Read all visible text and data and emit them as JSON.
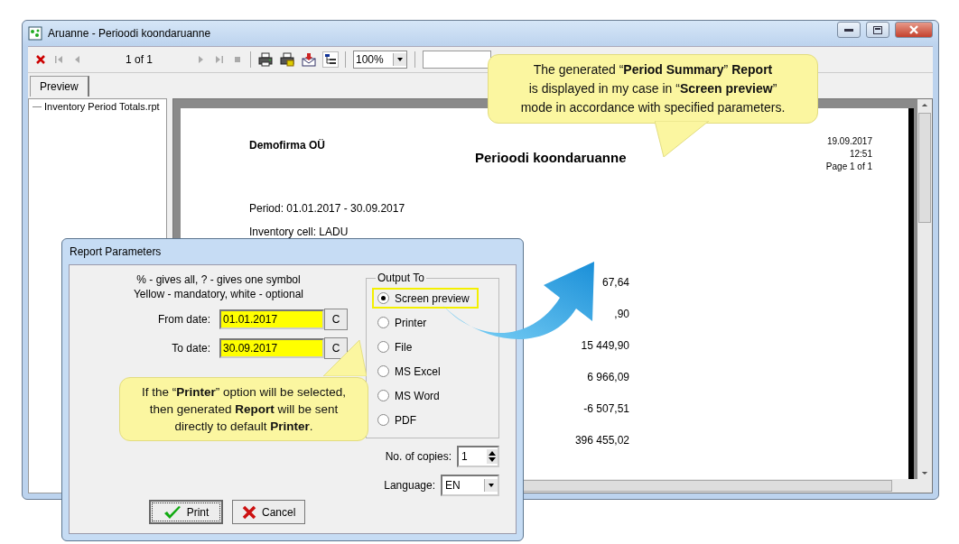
{
  "window": {
    "title": "Aruanne - Perioodi koondaruanne"
  },
  "toolbar": {
    "page": "1 of 1",
    "zoom": "100%"
  },
  "tabs": [
    {
      "label": "Preview",
      "selected": true
    }
  ],
  "tree": {
    "items": [
      {
        "label": "Inventory Period Totals.rpt"
      }
    ]
  },
  "report": {
    "company": "Demofirma OÜ",
    "title": "Perioodi koondaruanne",
    "date": "19.09.2017",
    "time": "12:51",
    "page": "Page 1 of 1",
    "lines": [
      "Period: 01.01.2017 - 30.09.2017",
      "Inventory cell: LADU"
    ],
    "values": [
      "67,64",
      ",90",
      "15 449,90",
      "6 966,09",
      "-6 507,51",
      "396 455,02"
    ]
  },
  "dialog": {
    "title": "Report Parameters",
    "hints": [
      "% - gives all, ? - gives one symbol",
      "Yellow - mandatory, white - optional"
    ],
    "fields": [
      {
        "label": "From date:",
        "value": "01.01.2017",
        "required": true,
        "button": "C"
      },
      {
        "label": "To date:",
        "value": "30.09.2017",
        "required": true,
        "button": "C"
      }
    ],
    "output": {
      "title": "Output To",
      "options": [
        {
          "label": "Screen preview",
          "selected": true,
          "highlighted": true
        },
        {
          "label": "Printer",
          "selected": false,
          "highlighted": false
        },
        {
          "label": "File",
          "selected": false,
          "highlighted": false
        },
        {
          "label": "MS Excel",
          "selected": false,
          "highlighted": false
        },
        {
          "label": "MS Word",
          "selected": false,
          "highlighted": false
        },
        {
          "label": "PDF",
          "selected": false,
          "highlighted": false
        }
      ]
    },
    "copies": {
      "label": "No. of copies:",
      "value": "1"
    },
    "language": {
      "label": "Language:",
      "value": "EN"
    },
    "buttons": [
      {
        "label": "Print",
        "kind": "ok"
      },
      {
        "label": "Cancel",
        "kind": "cancel"
      }
    ]
  },
  "callouts": [
    {
      "lines": [
        "The generated “**Period Summary**” **Report**",
        "is displayed in my case in “**Screen preview**”",
        "mode in accordance with specified parameters."
      ]
    },
    {
      "lines": [
        "If the “**Printer**” option will be selected,",
        "then generated **Report** will be sent",
        "directly to default **Printer**."
      ]
    }
  ]
}
